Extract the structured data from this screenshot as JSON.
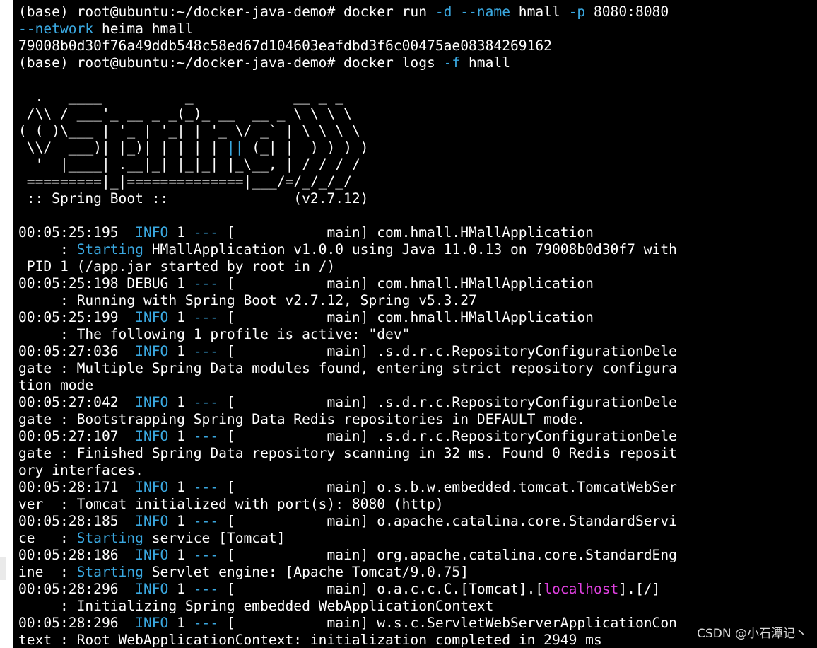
{
  "terminal": {
    "lines": [
      [
        {
          "t": "(base) root@ubuntu:~/docker-java-demo# docker run "
        },
        {
          "t": "-d",
          "c": "cyan"
        },
        {
          "t": " "
        },
        {
          "t": "--name",
          "c": "cyan"
        },
        {
          "t": " hmall "
        },
        {
          "t": "-p",
          "c": "cyan"
        },
        {
          "t": " 8080:8080"
        }
      ],
      [
        {
          "t": "--network",
          "c": "cyan"
        },
        {
          "t": " heima hmall"
        }
      ],
      [
        {
          "t": "79008b0d30f76a49ddb548c58ed67d104603eafdbd3f6c00475ae08384269162"
        }
      ],
      [
        {
          "t": "(base) root@ubuntu:~/docker-java-demo# docker logs "
        },
        {
          "t": "-f",
          "c": "cyan"
        },
        {
          "t": " hmall"
        }
      ],
      [
        {
          "t": ""
        }
      ],
      [
        {
          "t": "  .   ____          _            __ _ _"
        }
      ],
      [
        {
          "t": " /\\\\ / ___'_ __ _ _(_)_ __  __ _ \\ \\ \\ \\"
        }
      ],
      [
        {
          "t": "( ( )\\___ | '_ | '_| | '_ \\/ _` | \\ \\ \\ \\"
        }
      ],
      [
        {
          "t": " \\\\/  ___)| |_)| | | | | "
        },
        {
          "t": "||",
          "c": "cyan"
        },
        {
          "t": " (_| |  ) ) ) )"
        }
      ],
      [
        {
          "t": "  '  |____| .__|_| |_|_| |_\\__, | / / / /"
        }
      ],
      [
        {
          "t": " =========|_|==============|___/=/_/_/_/"
        }
      ],
      [
        {
          "t": " :: Spring Boot ::               (v2.7.12)"
        }
      ],
      [
        {
          "t": ""
        }
      ],
      [
        {
          "t": "00:05:25:195  "
        },
        {
          "t": "INFO",
          "c": "cyan"
        },
        {
          "t": " 1 "
        },
        {
          "t": "---",
          "c": "cyan"
        },
        {
          "t": " [           main] com.hmall.HMallApplication"
        }
      ],
      [
        {
          "t": "     : "
        },
        {
          "t": "Starting",
          "c": "cyan"
        },
        {
          "t": " HMallApplication v1.0.0 using Java 11.0.13 on 79008b0d30f7 with"
        }
      ],
      [
        {
          "t": " PID 1 (/app.jar started by root in /)"
        }
      ],
      [
        {
          "t": "00:05:25:198 DEBUG 1 "
        },
        {
          "t": "---",
          "c": "cyan"
        },
        {
          "t": " [           main] com.hmall.HMallApplication"
        }
      ],
      [
        {
          "t": "     : Running with Spring Boot v2.7.12, Spring v5.3.27"
        }
      ],
      [
        {
          "t": "00:05:25:199  "
        },
        {
          "t": "INFO",
          "c": "cyan"
        },
        {
          "t": " 1 "
        },
        {
          "t": "---",
          "c": "cyan"
        },
        {
          "t": " [           main] com.hmall.HMallApplication"
        }
      ],
      [
        {
          "t": "     : The following 1 profile is active: \"dev\""
        }
      ],
      [
        {
          "t": "00:05:27:036  "
        },
        {
          "t": "INFO",
          "c": "cyan"
        },
        {
          "t": " 1 "
        },
        {
          "t": "---",
          "c": "cyan"
        },
        {
          "t": " [           main] .s.d.r.c.RepositoryConfigurationDele"
        }
      ],
      [
        {
          "t": "gate : Multiple Spring Data modules found, entering strict repository configura"
        }
      ],
      [
        {
          "t": "tion mode"
        }
      ],
      [
        {
          "t": "00:05:27:042  "
        },
        {
          "t": "INFO",
          "c": "cyan"
        },
        {
          "t": " 1 "
        },
        {
          "t": "---",
          "c": "cyan"
        },
        {
          "t": " [           main] .s.d.r.c.RepositoryConfigurationDele"
        }
      ],
      [
        {
          "t": "gate : Bootstrapping Spring Data Redis repositories in DEFAULT mode."
        }
      ],
      [
        {
          "t": "00:05:27:107  "
        },
        {
          "t": "INFO",
          "c": "cyan"
        },
        {
          "t": " 1 "
        },
        {
          "t": "---",
          "c": "cyan"
        },
        {
          "t": " [           main] .s.d.r.c.RepositoryConfigurationDele"
        }
      ],
      [
        {
          "t": "gate : Finished Spring Data repository scanning in 32 ms. Found 0 Redis reposit"
        }
      ],
      [
        {
          "t": "ory interfaces."
        }
      ],
      [
        {
          "t": "00:05:28:171  "
        },
        {
          "t": "INFO",
          "c": "cyan"
        },
        {
          "t": " 1 "
        },
        {
          "t": "---",
          "c": "cyan"
        },
        {
          "t": " [           main] o.s.b.w.embedded.tomcat.TomcatWebSer"
        }
      ],
      [
        {
          "t": "ver  : Tomcat initialized with port(s): 8080 (http)"
        }
      ],
      [
        {
          "t": "00:05:28:185  "
        },
        {
          "t": "INFO",
          "c": "cyan"
        },
        {
          "t": " 1 "
        },
        {
          "t": "---",
          "c": "cyan"
        },
        {
          "t": " [           main] o.apache.catalina.core.StandardServi"
        }
      ],
      [
        {
          "t": "ce   : "
        },
        {
          "t": "Starting",
          "c": "cyan"
        },
        {
          "t": " service [Tomcat]"
        }
      ],
      [
        {
          "t": "00:05:28:186  "
        },
        {
          "t": "INFO",
          "c": "cyan"
        },
        {
          "t": " 1 "
        },
        {
          "t": "---",
          "c": "cyan"
        },
        {
          "t": " [           main] org.apache.catalina.core.StandardEng"
        }
      ],
      [
        {
          "t": "ine  : "
        },
        {
          "t": "Starting",
          "c": "cyan"
        },
        {
          "t": " Servlet engine: [Apache Tomcat/9.0.75]"
        }
      ],
      [
        {
          "t": "00:05:28:296  "
        },
        {
          "t": "INFO",
          "c": "cyan"
        },
        {
          "t": " 1 "
        },
        {
          "t": "---",
          "c": "cyan"
        },
        {
          "t": " [           main] o.a.c.c.C.[Tomcat].["
        },
        {
          "t": "localhost",
          "c": "magenta"
        },
        {
          "t": "].[/]"
        }
      ],
      [
        {
          "t": "     : Initializing Spring embedded WebApplicationContext"
        }
      ],
      [
        {
          "t": "00:05:28:296  "
        },
        {
          "t": "INFO",
          "c": "cyan"
        },
        {
          "t": " 1 "
        },
        {
          "t": "---",
          "c": "cyan"
        },
        {
          "t": " [           main] w.s.c.ServletWebServerApplicationCon"
        }
      ],
      [
        {
          "t": "text : Root WebApplicationContext: initialization completed in 2949 ms"
        }
      ]
    ]
  },
  "watermark": {
    "text": "CSDN @小石潭记丶"
  },
  "colors": {
    "background": "#000000",
    "text": "#ffffff",
    "cyan": "#3aa8e0",
    "magenta": "#e040e0"
  }
}
